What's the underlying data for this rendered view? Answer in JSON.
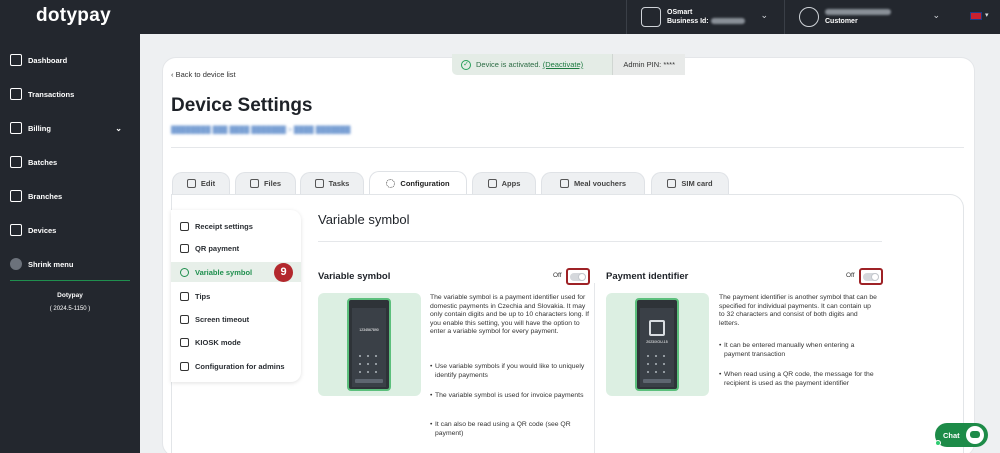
{
  "brand": {
    "logo": "dotypay"
  },
  "account": {
    "name": "OSmart",
    "business_label": "Business Id:",
    "user_role": "Customer"
  },
  "sidebar": {
    "items": [
      {
        "label": "Dashboard",
        "icon": "grid-icon"
      },
      {
        "label": "Transactions",
        "icon": "receipt-icon"
      },
      {
        "label": "Billing",
        "icon": "wallet-icon"
      },
      {
        "label": "Batches",
        "icon": "stack-icon"
      },
      {
        "label": "Branches",
        "icon": "branch-icon"
      },
      {
        "label": "Devices",
        "icon": "device-icon"
      },
      {
        "label": "Shrink menu",
        "icon": "shrink-icon"
      }
    ],
    "footer_brand": "Dotypay",
    "version": "( 2024.5-1150 )"
  },
  "status": {
    "text": "Device is activated.",
    "link": "(Deactivate)",
    "admin_pin": "Admin PIN: ****"
  },
  "page": {
    "back": "Back to device list",
    "title": "Device Settings"
  },
  "tabs": [
    {
      "label": "Edit"
    },
    {
      "label": "Files"
    },
    {
      "label": "Tasks"
    },
    {
      "label": "Configuration"
    },
    {
      "label": "Apps"
    },
    {
      "label": "Meal vouchers"
    },
    {
      "label": "SIM card"
    }
  ],
  "config_menu": [
    {
      "label": "Receipt settings"
    },
    {
      "label": "QR payment"
    },
    {
      "label": "Variable symbol"
    },
    {
      "label": "Tips"
    },
    {
      "label": "Screen timeout"
    },
    {
      "label": "KIOSK mode"
    },
    {
      "label": "Configuration for admins"
    }
  ],
  "step_badge": "9",
  "section": {
    "title": "Variable symbol",
    "variable": {
      "title": "Variable symbol",
      "toggle_label": "Off",
      "phone_text": "1234567890",
      "description": "The variable symbol is a payment identifier used for domestic payments in Czechia and Slovakia. It may only contain digits and be up to 10 characters long. If you enable this setting, you will have the option to enter a variable symbol for every payment.",
      "bullets": [
        "Use variable symbols if you would like to uniquely identify payments",
        "The variable symbol is used for invoice payments",
        "It can also be read using a QR code (see QR payment)"
      ]
    },
    "identifier": {
      "title": "Payment identifier",
      "toggle_label": "Off",
      "phone_text": "2023/XOU-15",
      "description": "The payment identifier is another symbol that can be specified for individual payments. It can contain up to 32 characters and consist of both digits and letters.",
      "bullets": [
        "It can be entered manually when entering a payment transaction",
        "When read using a QR code, the message for the recipient is used as the payment identifier"
      ]
    }
  },
  "chat": {
    "label": "Chat"
  },
  "colors": {
    "accent": "#1f8f4e",
    "dark": "#23272e",
    "highlight": "#9e2226"
  }
}
